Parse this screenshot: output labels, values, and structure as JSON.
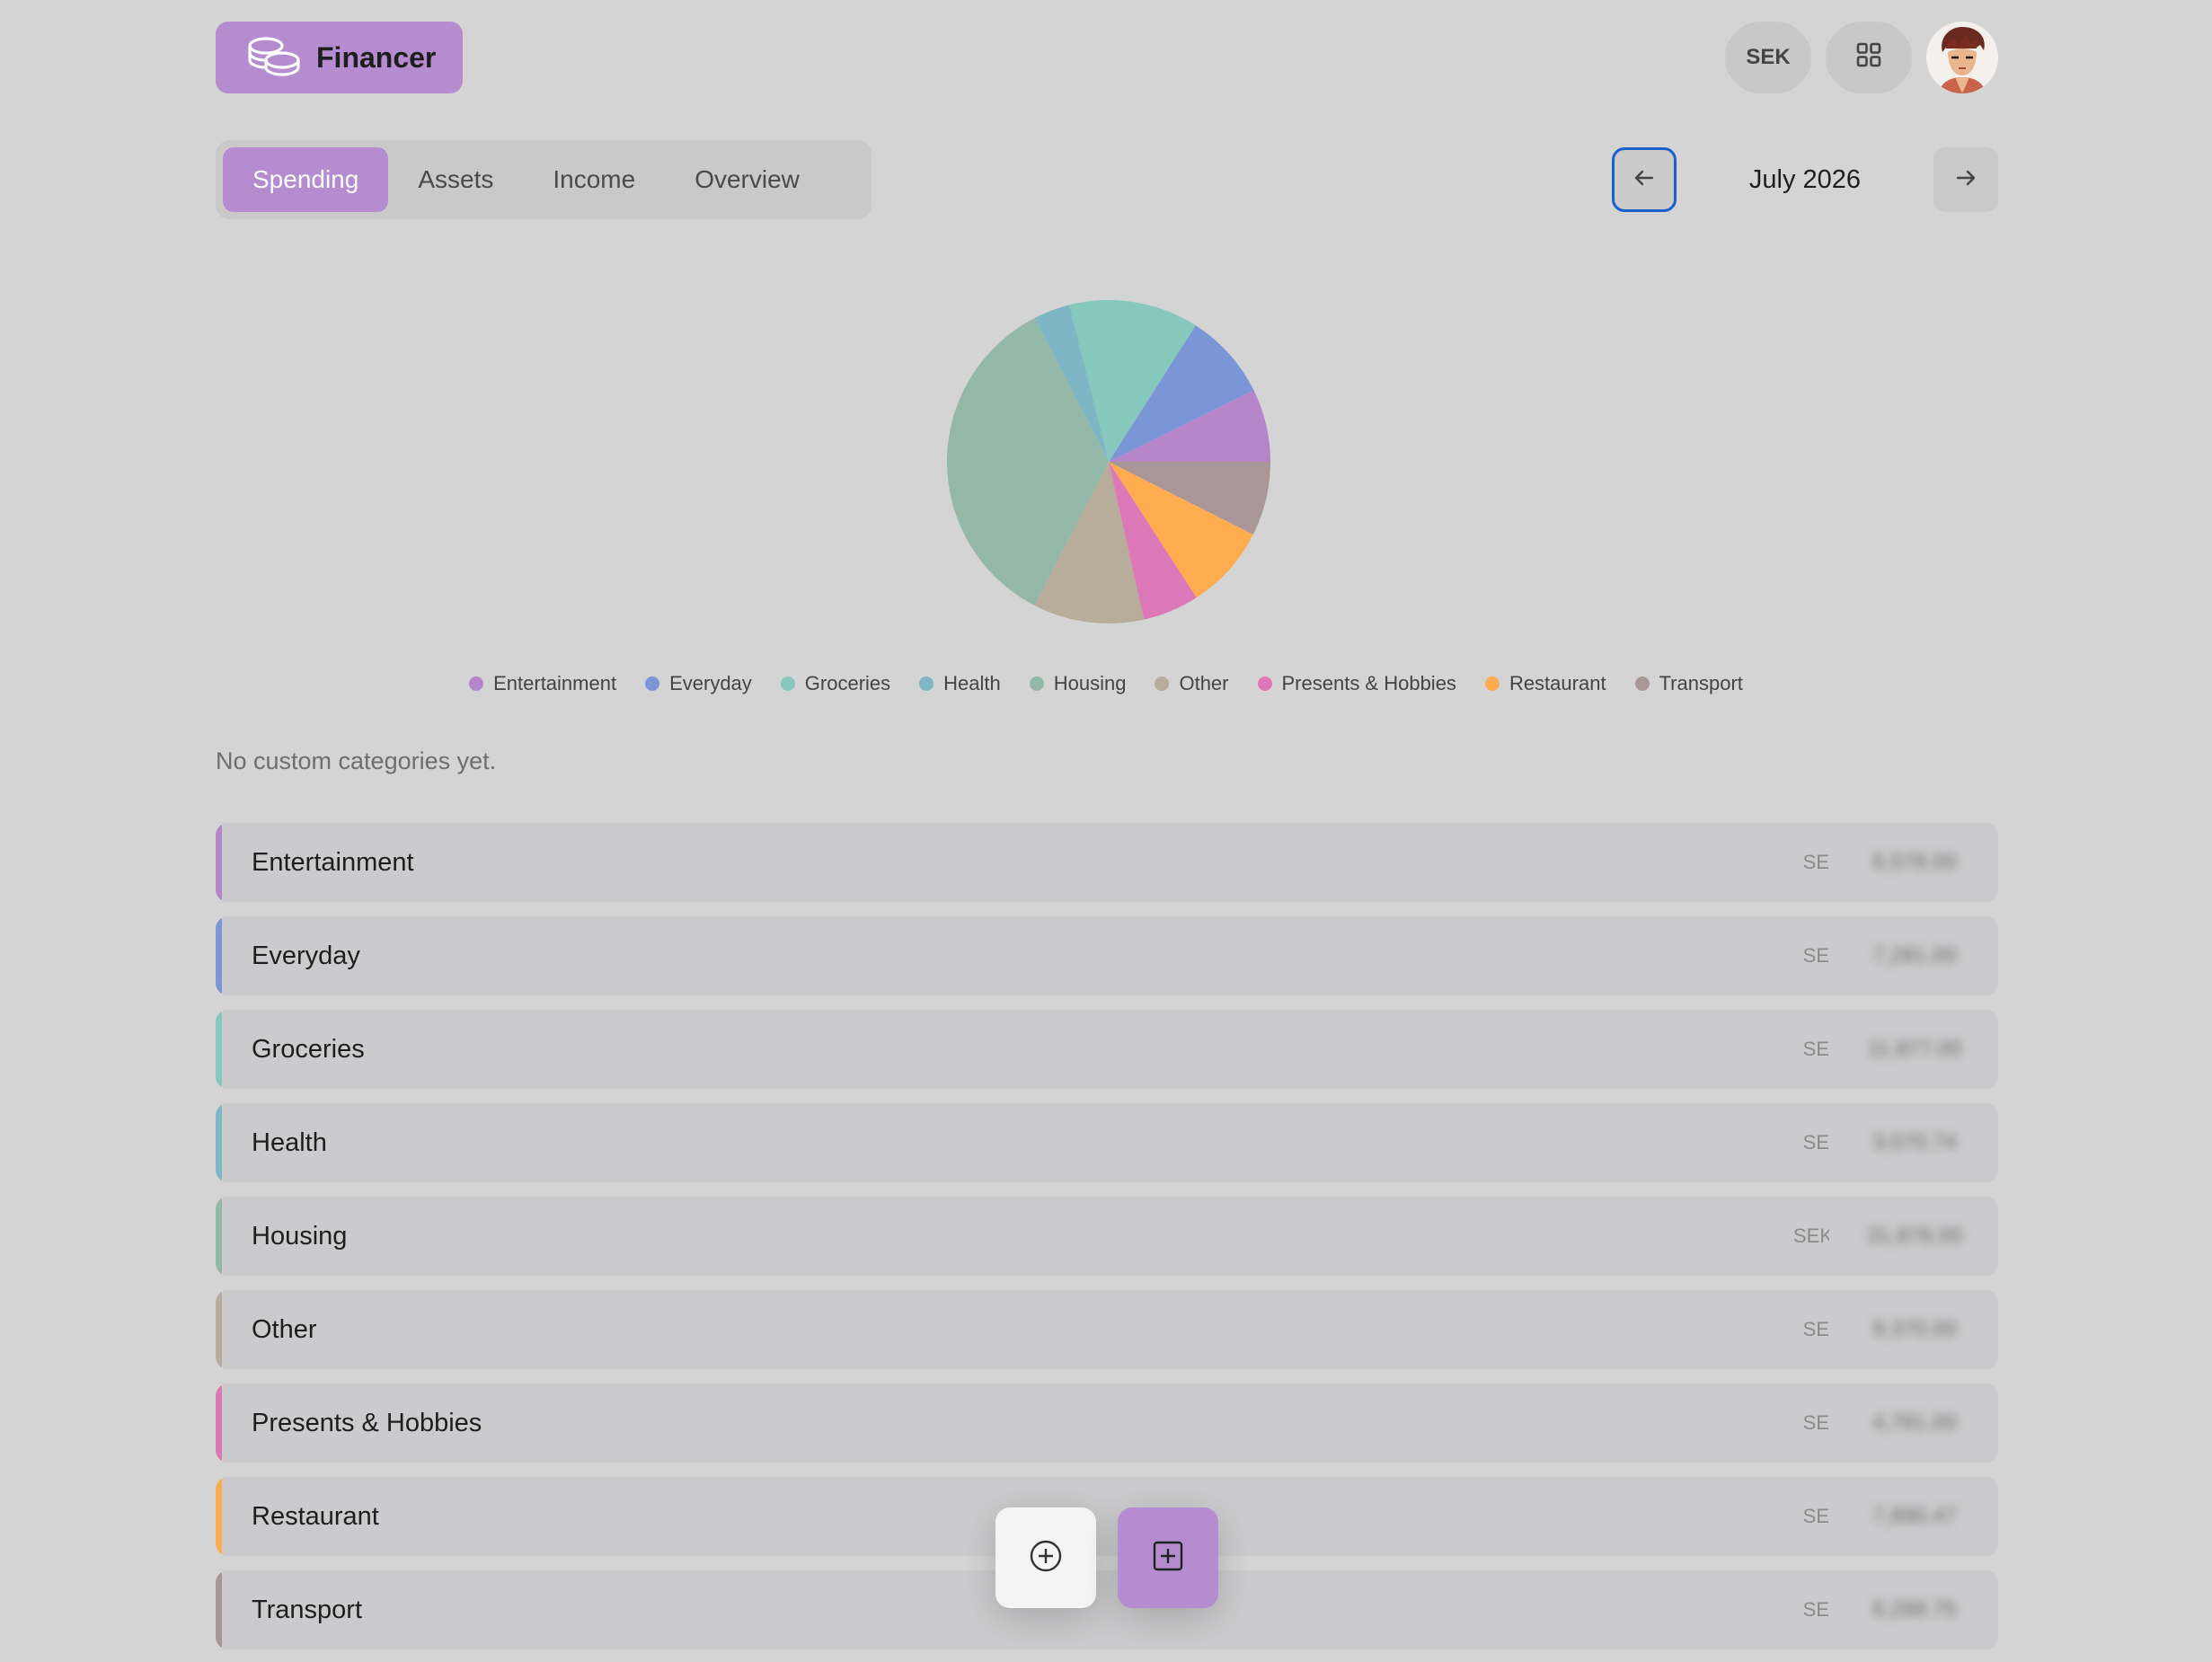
{
  "app": {
    "name": "Financer"
  },
  "header": {
    "currency": "SEK"
  },
  "tabs": [
    {
      "label": "Spending",
      "active": true
    },
    {
      "label": "Assets",
      "active": false
    },
    {
      "label": "Income",
      "active": false
    },
    {
      "label": "Overview",
      "active": false
    }
  ],
  "month_nav": {
    "month": "July 2026"
  },
  "chart_data": {
    "type": "pie",
    "categories": [
      "Entertainment",
      "Everyday",
      "Groceries",
      "Health",
      "Housing",
      "Other",
      "Presents & Hobbies",
      "Restaurant",
      "Transport"
    ],
    "colors": [
      "#b585ca",
      "#7b96d6",
      "#86c9bc",
      "#7fb6c6",
      "#94b8a8",
      "#b8ad9b",
      "#dd78b8",
      "#ffab4f",
      "#a99797"
    ],
    "values": [
      7.0,
      8.3,
      12.4,
      3.5,
      33.4,
      10.6,
      5.4,
      8.1,
      7.1
    ],
    "legend": "bottom"
  },
  "legend_labels": [
    "Entertainment",
    "Everyday",
    "Groceries",
    "Health",
    "Housing",
    "Other",
    "Presents & Hobbies",
    "Restaurant",
    "Transport"
  ],
  "no_custom_text": "No custom categories yet.",
  "categories": [
    {
      "name": "Entertainment",
      "currency": "SE",
      "amount": "6,578.00",
      "color": "#b585ca"
    },
    {
      "name": "Everyday",
      "currency": "SE",
      "amount": "7,281.00",
      "color": "#7b96d6"
    },
    {
      "name": "Groceries",
      "currency": "SE",
      "amount": "11,877.00",
      "color": "#86c9bc"
    },
    {
      "name": "Health",
      "currency": "SE",
      "amount": "3,070.74",
      "color": "#7fb6c6"
    },
    {
      "name": "Housing",
      "currency": "SEK",
      "amount": "31,876.00",
      "color": "#94b8a8"
    },
    {
      "name": "Other",
      "currency": "SE",
      "amount": "9,370.00",
      "color": "#b8ad9b"
    },
    {
      "name": "Presents & Hobbies",
      "currency": "SE",
      "amount": "4,781.00",
      "color": "#dd78b8"
    },
    {
      "name": "Restaurant",
      "currency": "SE",
      "amount": "7,890.47",
      "color": "#ffab4f"
    },
    {
      "name": "Transport",
      "currency": "SE",
      "amount": "6,288.75",
      "color": "#a99797"
    }
  ],
  "icons": {
    "logo": "coins-icon",
    "grid": "grid-icon",
    "prev": "arrow-left-icon",
    "next": "arrow-right-icon",
    "add": "plus-circle-icon",
    "add_square": "plus-square-icon"
  }
}
